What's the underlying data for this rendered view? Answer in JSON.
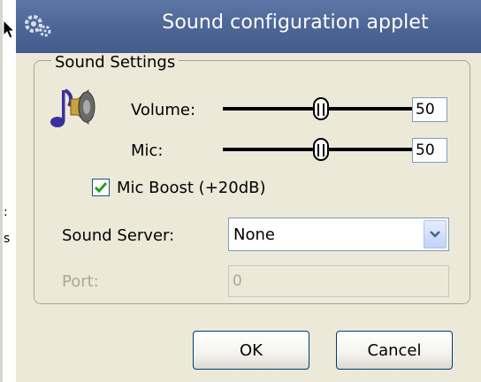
{
  "window": {
    "title": "Sound configuration applet",
    "titlebar_color": "#4e6797"
  },
  "group": {
    "title": "Sound Settings"
  },
  "volume": {
    "label": "Volume:",
    "value": "50",
    "level": 50
  },
  "mic": {
    "label": "Mic:",
    "value": "50",
    "level": 50
  },
  "mic_boost": {
    "label": "Mic Boost (+20dB)",
    "checked": true
  },
  "sound_server": {
    "label": "Sound Server:",
    "value": "None"
  },
  "port": {
    "label": "Port:",
    "value": "0",
    "disabled": true
  },
  "buttons": {
    "ok": "OK",
    "cancel": "Cancel"
  },
  "icons": {
    "title": "gears-icon",
    "speaker": "speaker-music-icon",
    "combo": "chevron-down-icon",
    "check": "checkmark-icon"
  },
  "colors": {
    "check": "#21a121",
    "disabled_text": "#aca899"
  }
}
